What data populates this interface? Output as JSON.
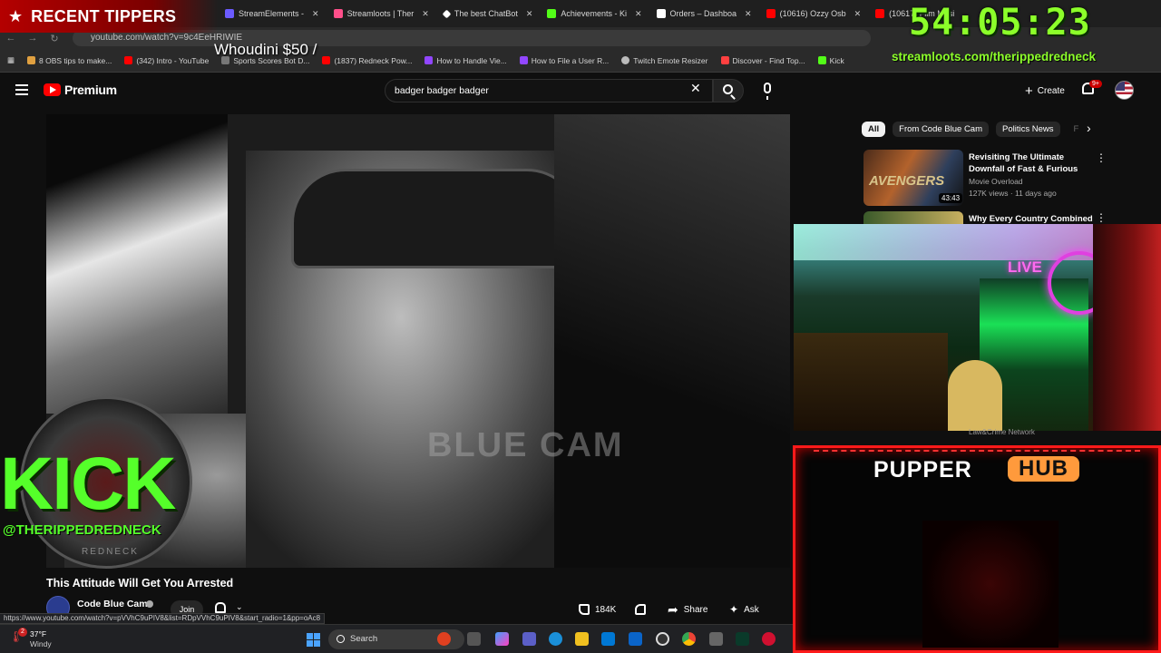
{
  "browser": {
    "tabs": [
      {
        "label": "StreamElements -",
        "color": "#6b5bff"
      },
      {
        "label": "Streamloots | Ther",
        "color": "#ff4f8a"
      },
      {
        "label": "The best ChatBot",
        "color": "#ffffff"
      },
      {
        "label": "Achievements - Ki",
        "color": "#53fc18"
      },
      {
        "label": "Orders – Dashboa",
        "color": "#ffffff"
      },
      {
        "label": "(10616) Ozzy Osb",
        "color": "#ff0000"
      },
      {
        "label": "(10617) Film Musi",
        "color": "#ff0000"
      }
    ],
    "address": "youtube.com/watch?v=9c4EeHRIWIE",
    "bookmarks": [
      {
        "label": "8 OBS tips to make...",
        "color": "#e0a040"
      },
      {
        "label": "(342) Intro - YouTube",
        "color": "#ff0000"
      },
      {
        "label": "Sports Scores Bot D...",
        "color": "#777777"
      },
      {
        "label": "(1837) Redneck Pow...",
        "color": "#ff0000"
      },
      {
        "label": "How to Handle Vie...",
        "color": "#9146ff"
      },
      {
        "label": "How to File a User R...",
        "color": "#9146ff"
      },
      {
        "label": "Twitch Emote Resizer",
        "color": "#bbbbbb"
      },
      {
        "label": "Discover - Find Top...",
        "color": "#ff4040"
      },
      {
        "label": "Kick",
        "color": "#53fc18"
      }
    ]
  },
  "youtube": {
    "logo_text": "Premium",
    "search_query": "badger badger badger",
    "create_label": "Create",
    "notification_count": "9+",
    "video": {
      "watermark": "BLUE CAM",
      "title": "This Attitude Will Get You Arrested",
      "channel": "Code Blue Cam",
      "join_label": "Join",
      "likes": "184K",
      "share_label": "Share",
      "ask_label": "Ask"
    },
    "status_url": "https://www.youtube.com/watch?v=pVVhC9uPIV8&list=RDpVVhC9uPIV8&start_radio=1&pp=oAc8",
    "chips": [
      "All",
      "From Code Blue Cam",
      "Politics News",
      "F"
    ],
    "recommendations": [
      {
        "title": "Revisiting The Ultimate Downfall of Fast & Furious",
        "channel": "Movie Overload",
        "meta": "127K views · 11 days ago",
        "duration": "43:43",
        "thumb_text": "AVENGERS"
      },
      {
        "title": "Why Every Country Combined",
        "channel": "",
        "meta": "",
        "duration": "",
        "thumb_text": ""
      }
    ],
    "partial_rec_meta": "Law&Crime Network"
  },
  "overlays": {
    "recent_tippers_title": "RECENT TIPPERS",
    "tipper": "Whoudini $50 /",
    "timer": "54:05:23",
    "timer_url": "streamloots.com/therippedredneck",
    "kick_text": "KICK",
    "kick_handle": "@THERIPPEDREDNECK",
    "kick_sub": "REDNECK",
    "webcam_live": "LIVE",
    "pupper_title": "PUPPER",
    "pupper_hub": "HUB"
  },
  "taskbar": {
    "weather_temp": "37°F",
    "weather_desc": "Windy",
    "weather_badge": "2",
    "search_label": "Search"
  }
}
